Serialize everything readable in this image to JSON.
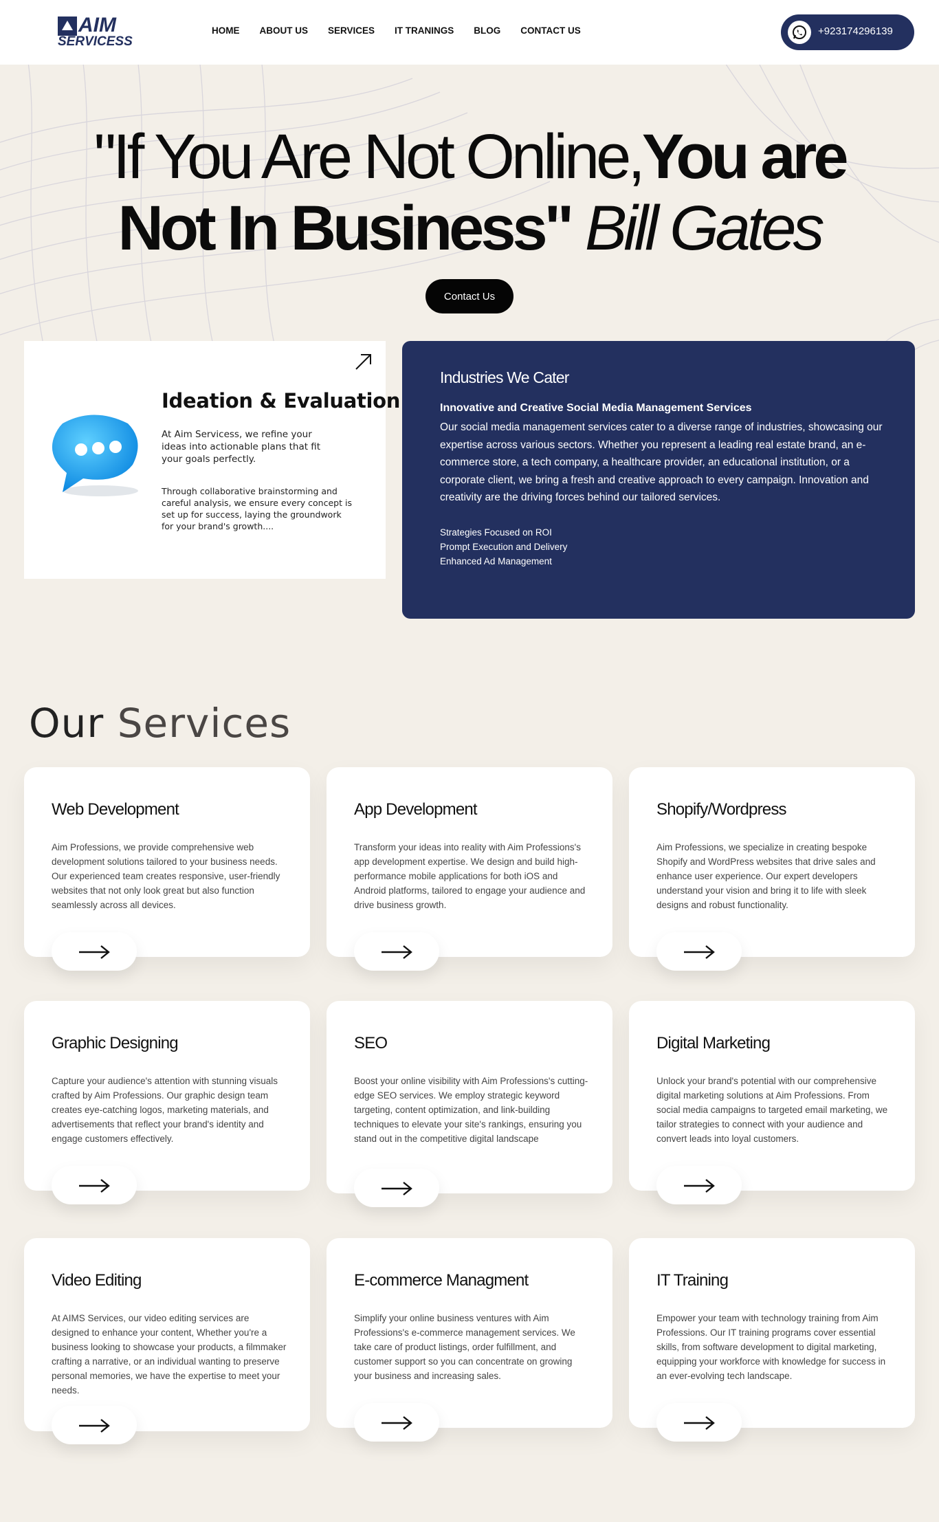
{
  "header": {
    "logo_top": "AIM",
    "logo_bottom": "SERVICESS",
    "nav": [
      "HOME",
      "ABOUT US",
      "SERVICES",
      "IT TRANINGS",
      "BLOG",
      "CONTACT US"
    ],
    "phone": "+923174296139",
    "phone_icon": "whatsapp-icon"
  },
  "hero": {
    "line1_thin": "\"If You Are Not Online,",
    "line1_bold": "You are",
    "line2_bold": "Not In Business\"",
    "line2_italic": "Bill Gates",
    "button": "Contact Us"
  },
  "ideation": {
    "title": "Ideation & Evaluation",
    "p1": "At Aim Servicess, we refine your ideas into actionable plans that fit your goals perfectly.",
    "p2": "Through collaborative brainstorming and careful analysis, we ensure every concept is set up for success, laying the groundwork for your brand's growth...."
  },
  "industries": {
    "title": "Industries We Cater",
    "subtitle": "Innovative and Creative Social Media Management Services",
    "description": "Our social media management services cater to a diverse range of industries, showcasing our expertise across various sectors. Whether you represent a leading real estate brand, an e-commerce store, a tech company, a healthcare provider, an educational institution, or a corporate client, we bring a fresh and creative approach to every campaign. Innovation and creativity are the driving forces behind our tailored services.",
    "features": [
      "Strategies Focused on ROI",
      "Prompt Execution and Delivery",
      "Enhanced Ad Management"
    ]
  },
  "services": {
    "title_part1": "Our",
    "title_part2": "Services",
    "cards": [
      {
        "title": "Web Development",
        "desc": "Aim Professions, we provide comprehensive web development solutions tailored to your business needs. Our experienced team creates responsive, user-friendly websites that not only look great but also function seamlessly across all devices."
      },
      {
        "title": "App Development",
        "desc": "Transform your ideas into reality with Aim Professions's app development expertise. We design and build high-performance mobile applications for both iOS and Android platforms, tailored to engage your audience and drive business growth."
      },
      {
        "title": "Shopify/Wordpress",
        "desc": "Aim Professions, we specialize in creating bespoke Shopify and WordPress websites that drive sales and enhance user experience. Our expert developers understand your vision and bring it to life with sleek designs and robust functionality."
      },
      {
        "title": "Graphic Designing",
        "desc": "Capture your audience's attention with stunning visuals crafted by Aim Professions. Our graphic design team creates eye-catching logos, marketing materials, and advertisements that reflect your brand's identity and engage customers effectively."
      },
      {
        "title": "SEO",
        "desc": "Boost your online visibility with Aim Professions's cutting-edge SEO services. We employ strategic keyword targeting, content optimization, and link-building techniques to elevate your site's rankings, ensuring you stand out in the competitive digital landscape"
      },
      {
        "title": "Digital Marketing",
        "desc": "Unlock your brand's potential with our comprehensive digital marketing solutions at Aim Professions. From social media campaigns to targeted email marketing, we tailor strategies to connect with your audience and convert leads into loyal customers."
      },
      {
        "title": "Video Editing",
        "desc": "At AIMS Services, our video editing services are designed to enhance your content, Whether you're a business looking to showcase your products, a filmmaker crafting a narrative, or an individual wanting to preserve personal memories, we have the expertise to meet your needs."
      },
      {
        "title": "E-commerce Managment",
        "desc": "Simplify your online business ventures with Aim Professions's e-commerce management services. We take care of product listings, order fulfillment, and customer support so you can concentrate on growing your business and increasing sales."
      },
      {
        "title": "IT Training",
        "desc": "Empower your team with technology training from Aim Professions. Our IT training programs cover essential skills, from software development to digital marketing, equipping your workforce with knowledge for success in an ever-evolving tech landscape."
      }
    ]
  }
}
